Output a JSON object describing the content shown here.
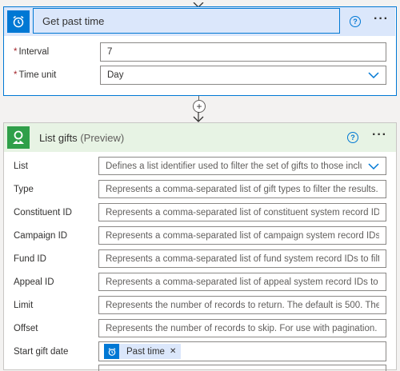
{
  "get_past_time": {
    "title": "Get past time",
    "fields": [
      {
        "label": "Interval",
        "required": true,
        "value": "7"
      },
      {
        "label": "Time unit",
        "required": true,
        "value": "Day"
      }
    ]
  },
  "connector": {
    "add_symbol": "+"
  },
  "list_gifts": {
    "title": "List gifts",
    "title_suffix": "(Preview)",
    "fields": [
      {
        "label": "List",
        "placeholder": "Defines a list identifier used to filter the set of gifts to those included in t"
      },
      {
        "label": "Type",
        "placeholder": "Represents a comma-separated list of gift types to filter the results. For examp"
      },
      {
        "label": "Constituent ID",
        "placeholder": "Represents a comma-separated list of constituent system record IDs to filter th"
      },
      {
        "label": "Campaign ID",
        "placeholder": "Represents a comma-separated list of campaign system record IDs to filter the"
      },
      {
        "label": "Fund ID",
        "placeholder": "Represents a comma-separated list of fund system record IDs to filter the resul"
      },
      {
        "label": "Appeal ID",
        "placeholder": "Represents a comma-separated list of appeal system record IDs to filter the res"
      },
      {
        "label": "Limit",
        "placeholder": "Represents the number of records to return. The default is 500. The maximum"
      },
      {
        "label": "Offset",
        "placeholder": "Represents the number of records to skip. For use with pagination."
      },
      {
        "label": "Start gift date",
        "token": "Past time",
        "token_remove": "✕"
      }
    ]
  },
  "colors": {
    "accent_blue": "#0078d4",
    "header_blue_bg": "#dbe7fb",
    "header_green_bg": "#e7f3e4",
    "green_icon": "#2f9f49",
    "required": "#a4262c"
  },
  "icons": [
    "alarm-clock-icon",
    "help-icon",
    "more-icon",
    "chevron-down-icon",
    "add-icon",
    "arrow-down-icon",
    "blackbaud-icon",
    "remove-icon"
  ]
}
